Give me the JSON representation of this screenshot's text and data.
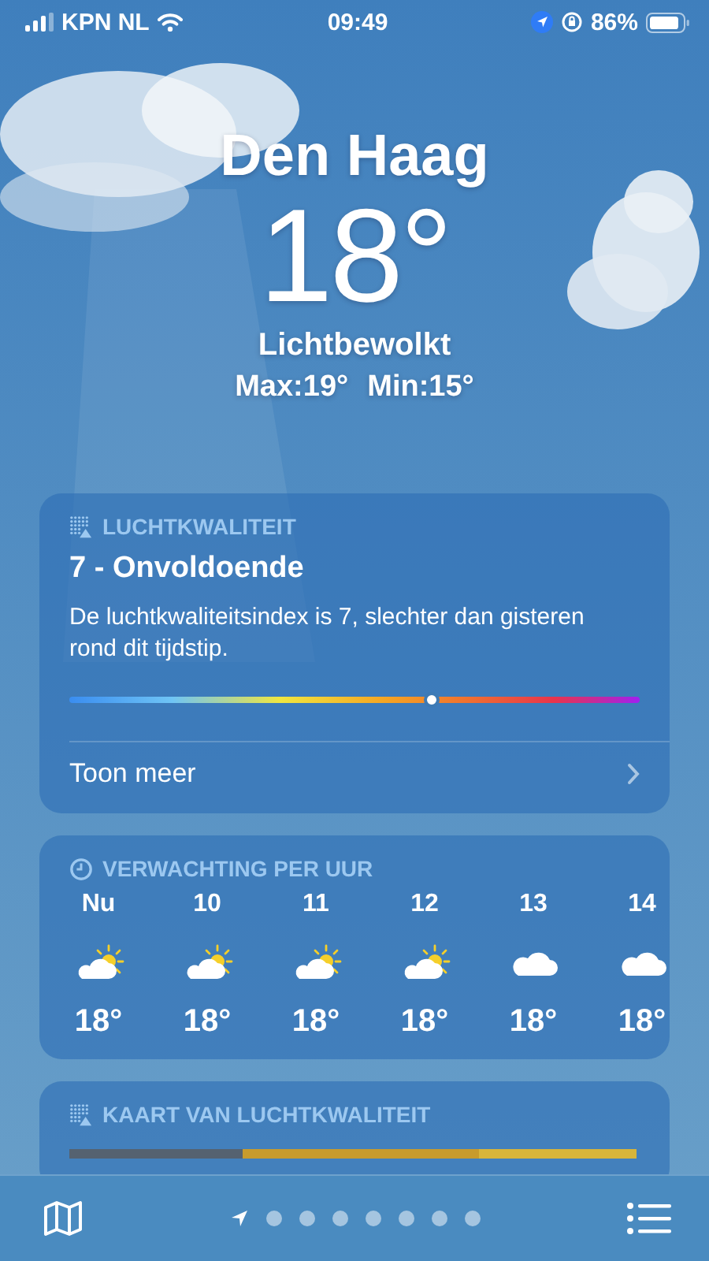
{
  "status_bar": {
    "carrier": "KPN NL",
    "time": "09:49",
    "battery": "86%"
  },
  "location": {
    "city": "Den Haag",
    "temperature": "18°",
    "condition": "Lichtbewolkt",
    "high": "Max:19°",
    "low": "Min:15°"
  },
  "air_quality": {
    "header": "LUCHTKWALITEIT",
    "title": "7 - Onvoldoende",
    "description": "De luchtkwaliteitsindex is 7, slechter dan gisteren rond dit tijdstip.",
    "level": 0.634,
    "link": "Toon meer"
  },
  "hourly": {
    "header": "VERWACHTING PER UUR",
    "hours": [
      {
        "label": "Nu",
        "kind": "partly_cloudy",
        "temp": "18°"
      },
      {
        "label": "10",
        "kind": "partly_cloudy",
        "temp": "18°"
      },
      {
        "label": "11",
        "kind": "partly_cloudy",
        "temp": "18°"
      },
      {
        "label": "12",
        "kind": "partly_cloudy",
        "temp": "18°"
      },
      {
        "label": "13",
        "kind": "cloudy",
        "temp": "18°"
      },
      {
        "label": "14",
        "kind": "cloudy",
        "temp": "18°"
      }
    ]
  },
  "air_quality_map": {
    "header": "KAART VAN LUCHTKWALITEIT"
  },
  "page_indicator": [
    {
      "kind": "location",
      "selected": true
    },
    {
      "kind": "dot",
      "selected": false
    },
    {
      "kind": "dot",
      "selected": false
    },
    {
      "kind": "dot",
      "selected": false
    },
    {
      "kind": "dot",
      "selected": false
    },
    {
      "kind": "dot",
      "selected": false
    },
    {
      "kind": "dot",
      "selected": false
    },
    {
      "kind": "dot",
      "selected": false
    }
  ]
}
